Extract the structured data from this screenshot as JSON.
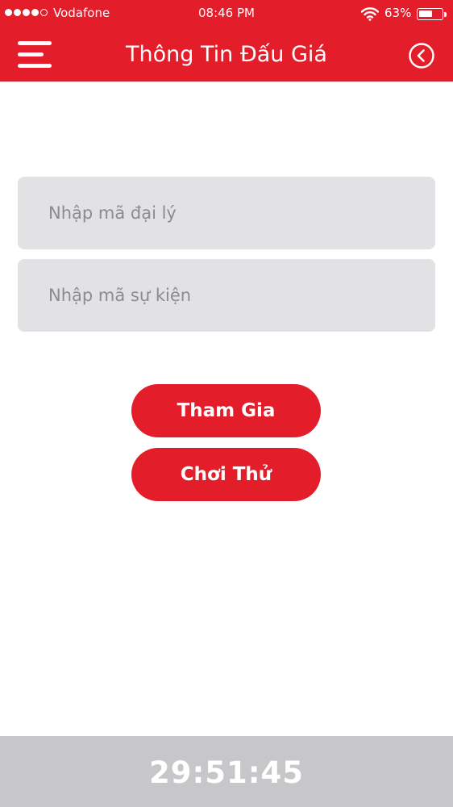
{
  "status_bar": {
    "carrier": "Vodafone",
    "signal_bars_filled": 4,
    "signal_bars_total": 5,
    "time": "08:46 PM",
    "battery_percent": "63%",
    "battery_level": 0.63,
    "wifi_icon": "wifi-icon"
  },
  "header": {
    "title": "Thông Tin Đấu Giá",
    "menu_icon": "hamburger-menu-icon",
    "back_icon": "back-circle-icon",
    "accent_color": "#e31e2a"
  },
  "form": {
    "agent_code_placeholder": "Nhập mã đại lý",
    "event_code_placeholder": "Nhập mã sự kiện",
    "join_label": "Tham Gia",
    "trial_label": "Chơi Thử"
  },
  "footer": {
    "countdown": "29:51:45",
    "background_color": "#c7c7c9"
  }
}
